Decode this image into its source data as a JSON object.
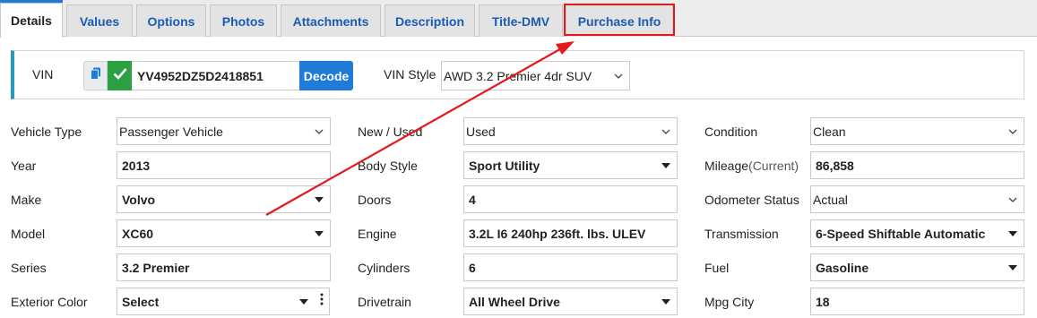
{
  "tabs": [
    {
      "label": "Details",
      "active": true
    },
    {
      "label": "Values"
    },
    {
      "label": "Options"
    },
    {
      "label": "Photos"
    },
    {
      "label": "Attachments"
    },
    {
      "label": "Description"
    },
    {
      "label": "Title-DMV"
    },
    {
      "label": "Purchase Info",
      "highlighted": true
    }
  ],
  "vin": {
    "label": "VIN",
    "value": "YV4952DZ5D2418851",
    "decode_label": "Decode",
    "style_label": "VIN Style",
    "style_value": "AWD 3.2 Premier 4dr SUV"
  },
  "fields": {
    "vehicle_type": {
      "label": "Vehicle Type",
      "value": "Passenger Vehicle"
    },
    "year": {
      "label": "Year",
      "value": "2013"
    },
    "make": {
      "label": "Make",
      "value": "Volvo"
    },
    "model": {
      "label": "Model",
      "value": "XC60"
    },
    "series": {
      "label": "Series",
      "value": "3.2 Premier"
    },
    "exterior_color": {
      "label": "Exterior Color",
      "value": "Select"
    },
    "new_used": {
      "label": "New / Used",
      "value": "Used"
    },
    "body_style": {
      "label": "Body Style",
      "value": "Sport Utility"
    },
    "doors": {
      "label": "Doors",
      "value": "4"
    },
    "engine": {
      "label": "Engine",
      "value": "3.2L I6 240hp 236ft. lbs. ULEV"
    },
    "cylinders": {
      "label": "Cylinders",
      "value": "6"
    },
    "drivetrain": {
      "label": "Drivetrain",
      "value": "All Wheel Drive"
    },
    "condition": {
      "label": "Condition",
      "value": "Clean"
    },
    "mileage": {
      "label": "Mileage",
      "label_sub": "(Current)",
      "value": "86,858"
    },
    "odometer_status": {
      "label": "Odometer Status",
      "value": "Actual"
    },
    "transmission": {
      "label": "Transmission",
      "value": "6-Speed Shiftable Automatic"
    },
    "fuel": {
      "label": "Fuel",
      "value": "Gasoline"
    },
    "mpg_city": {
      "label": "Mpg City",
      "value": "18"
    }
  },
  "colors": {
    "tab_link": "#1a5bb5",
    "accent_blue": "#1e7bd7",
    "check_green": "#2aa043",
    "panel_accent": "#2a98b8",
    "annotation_red": "#e3191b"
  },
  "icons": [
    "copy-icon",
    "check-icon",
    "chevron-down-icon",
    "caret-down-icon",
    "kebab-icon"
  ]
}
